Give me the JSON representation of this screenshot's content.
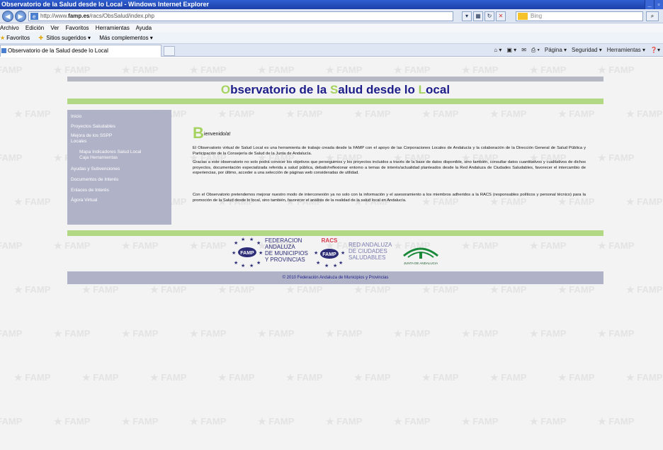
{
  "window": {
    "title": "Observatorio de la Salud desde lo Local - Windows Internet Explorer",
    "controls": [
      "_",
      "▫"
    ]
  },
  "address_bar": {
    "url_prefix": "http://www.",
    "url_host": "famp.es",
    "url_path": "/racs/ObsSalud/index.php",
    "search_placeholder": "Bing"
  },
  "menu": [
    "Archivo",
    "Edición",
    "Ver",
    "Favoritos",
    "Herramientas",
    "Ayuda"
  ],
  "favorites_bar": {
    "favorites_label": "Favoritos",
    "items": [
      "Sitios sugeridos ▾",
      "Más complementos ▾"
    ]
  },
  "tab": {
    "title": "Observatorio de la Salud desde lo Local"
  },
  "command_bar": [
    "Página ▾",
    "Seguridad ▾",
    "Herramientas ▾"
  ],
  "page": {
    "headline": {
      "O": "O",
      "bservatorio": "bservatorio de la ",
      "S": "S",
      "alud": "alud desde lo ",
      "L": "L",
      "ocal": "ocal"
    },
    "sidebar": {
      "items": [
        "Inicio",
        "Proyectos Saludables",
        "Mejora de los SSPP",
        "Locales",
        "Ayudas y Subvenciones",
        "Documentos de Interés",
        "Enlaces de Interés",
        "Ágora Virtual"
      ],
      "subitems": [
        "Mapa Indicadores Salud Local",
        "Caja Herramientas"
      ]
    },
    "welcome": {
      "letter": "B",
      "rest": "ienvenido/a!"
    },
    "paragraphs": [
      "El Observatorio virtual de Salud Local es una herramienta de trabajo creada desde la FAMP con el apoyo de las Corporaciones Locales de Andalucía y la colaboración de la Dirección General de Salud Pública y Participación de la Consejería de Salud de la Junta de Andalucía.",
      "Gracias a este observatorio no solo podrá conocer los objetivos que perseguimos y los proyectos incluidos a través de la base de datos disponible, sino también, consultar datos cuantitativos y cualitativos de dichos proyectos, documentación especializada referida a salud pública, debatir/reflexionar entorno a temas de interés/actualidad planteados desde la Red Andaluza de Ciudades Saludables, favorecer el intercambio de experiencias, por último, acceder a una selección de páginas web consideradas de utilidad.",
      "Con el Observatorio pretendemos mejorar nuestro modo de interconexión ya no solo con la información y el asesoramiento a los miembros adheridos a la RACS (responsables políticos y personal técnico) para la promoción de la Salud desde lo local, sino también, favorecer el análisis de la realidad de la salud local en Andalucía."
    ],
    "logos": {
      "famp": [
        "FEDERACION",
        "ANDALUZA",
        "DE MUNICIPIOS",
        "Y PROVINCIAS"
      ],
      "famp_badge": "FAMP",
      "racs": [
        "RED ANDALUZA",
        "DE CIUDADES",
        "SALUDABLES"
      ],
      "racs_badge": "RACS",
      "junta": "JUNTA DE ANDALUCIA"
    },
    "footer": "© 2010 Federación Andaluza de Municipios y Provincias",
    "watermark": "FAMP"
  },
  "colors": {
    "headline_blue": "#1d1d8a",
    "accent_green": "#a6d35f",
    "sidebar_bg": "#b0b3c7"
  }
}
